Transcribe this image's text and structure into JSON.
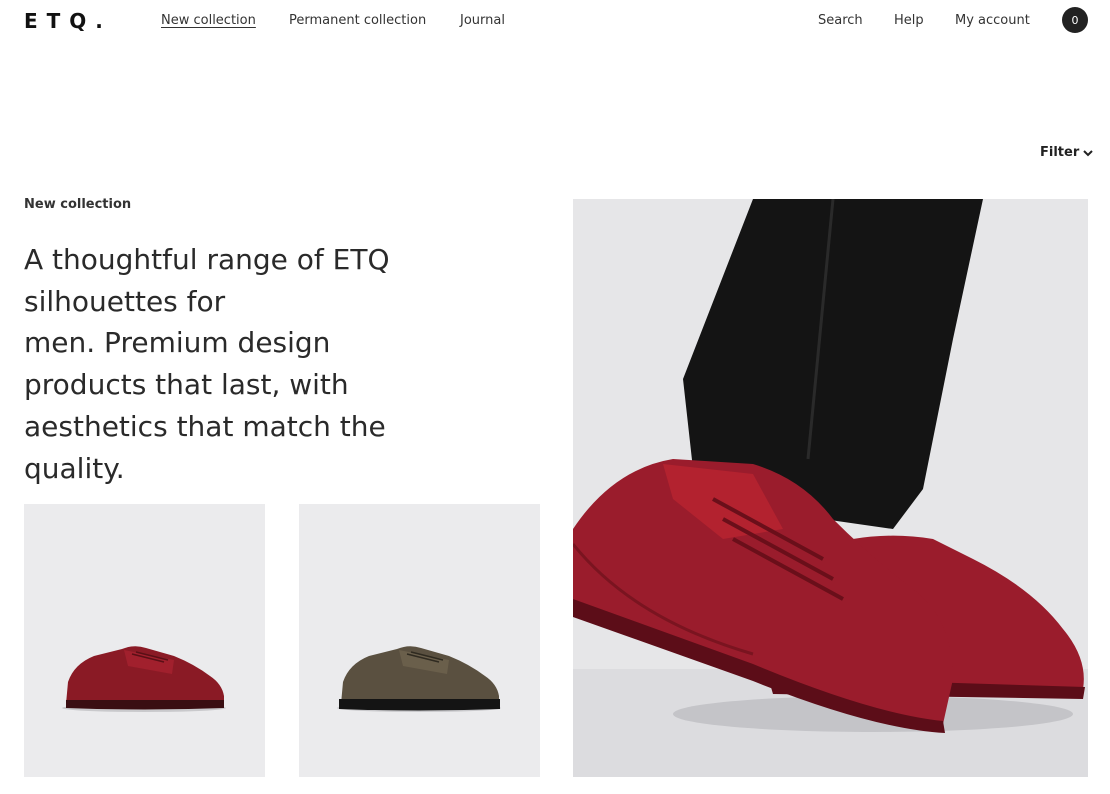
{
  "header": {
    "logo": "ETQ.",
    "nav": {
      "new_collection": "New collection",
      "permanent_collection": "Permanent collection",
      "journal": "Journal"
    },
    "utility": {
      "search": "Search",
      "help": "Help",
      "account": "My account",
      "cart_count": "0"
    }
  },
  "filter": {
    "label": "Filter",
    "icon": "chevron-down-icon"
  },
  "collection": {
    "breadcrumb": "New collection",
    "intro_lines": [
      "A thoughtful range of ETQ",
      "silhouettes for",
      "men. Premium design",
      "products that last, with",
      "aesthetics that match the",
      "quality."
    ]
  },
  "products": [
    {
      "color": "#8a1a25"
    },
    {
      "color": "#5a5040"
    }
  ],
  "hero": {
    "shoe_color": "#9a1c2c",
    "accent_color": "#b3222f",
    "trouser_color": "#141414"
  }
}
